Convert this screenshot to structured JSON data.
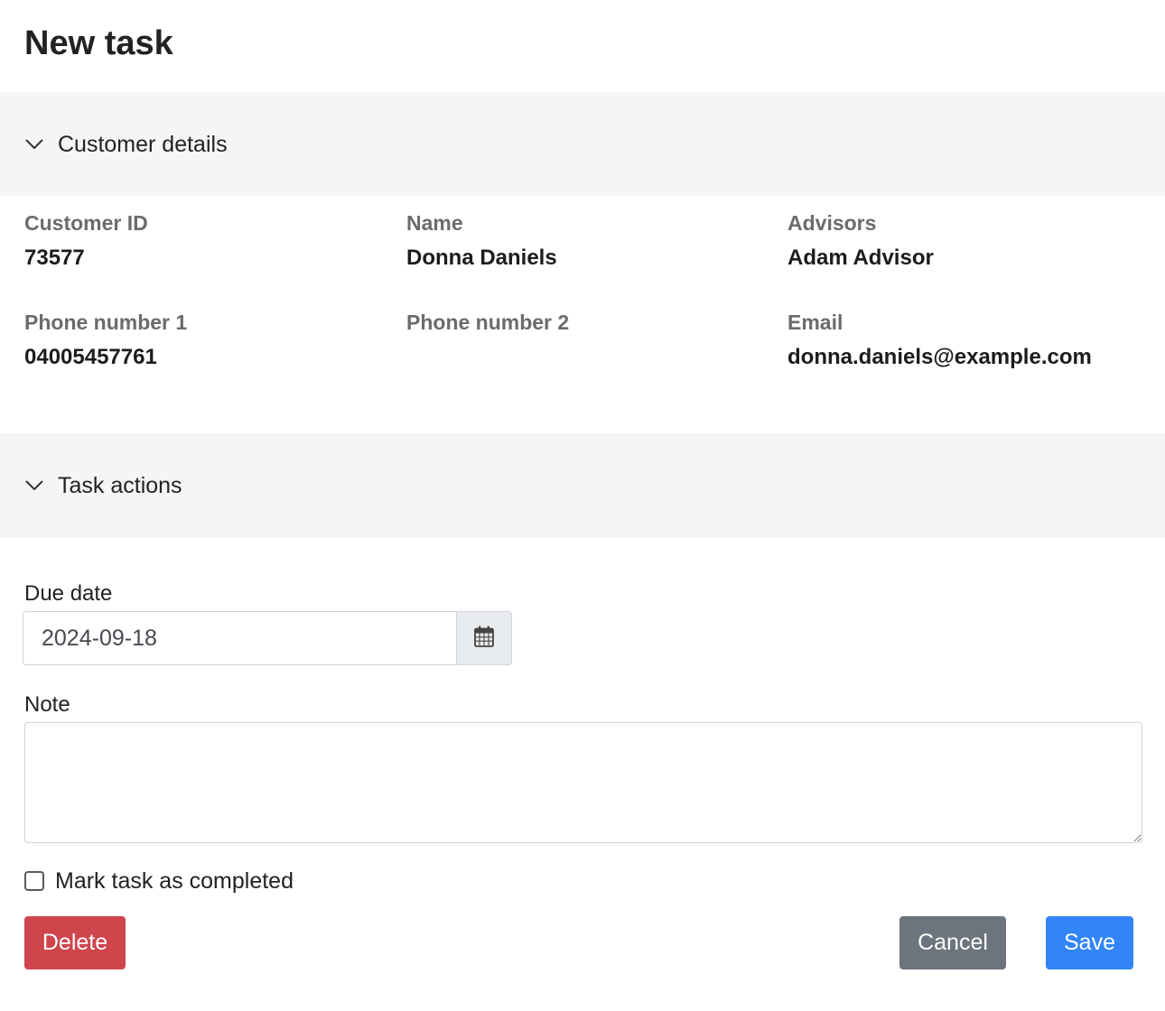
{
  "page": {
    "title": "New task"
  },
  "customer_section": {
    "title": "Customer details",
    "fields": [
      {
        "label": "Customer ID",
        "value": "73577"
      },
      {
        "label": "Name",
        "value": "Donna Daniels"
      },
      {
        "label": "Advisors",
        "value": "Adam Advisor"
      },
      {
        "label": "Phone number 1",
        "value": "04005457761"
      },
      {
        "label": "Phone number 2",
        "value": ""
      },
      {
        "label": "Email",
        "value": "donna.daniels@example.com"
      }
    ]
  },
  "actions_section": {
    "title": "Task actions",
    "due_date_label": "Due date",
    "due_date_value": "2024-09-18",
    "note_label": "Note",
    "note_value": "",
    "completed_label": "Mark task as completed",
    "completed_checked": false
  },
  "buttons": {
    "delete_label": "Delete",
    "cancel_label": "Cancel",
    "save_label": "Save"
  },
  "colors": {
    "section_bg": "#f5f5f5",
    "delete": "#d0454c",
    "cancel": "#6c757d",
    "save": "#3285f7"
  },
  "icons": {
    "section_toggle": "chevron-down-icon",
    "date_picker": "calendar-icon"
  }
}
